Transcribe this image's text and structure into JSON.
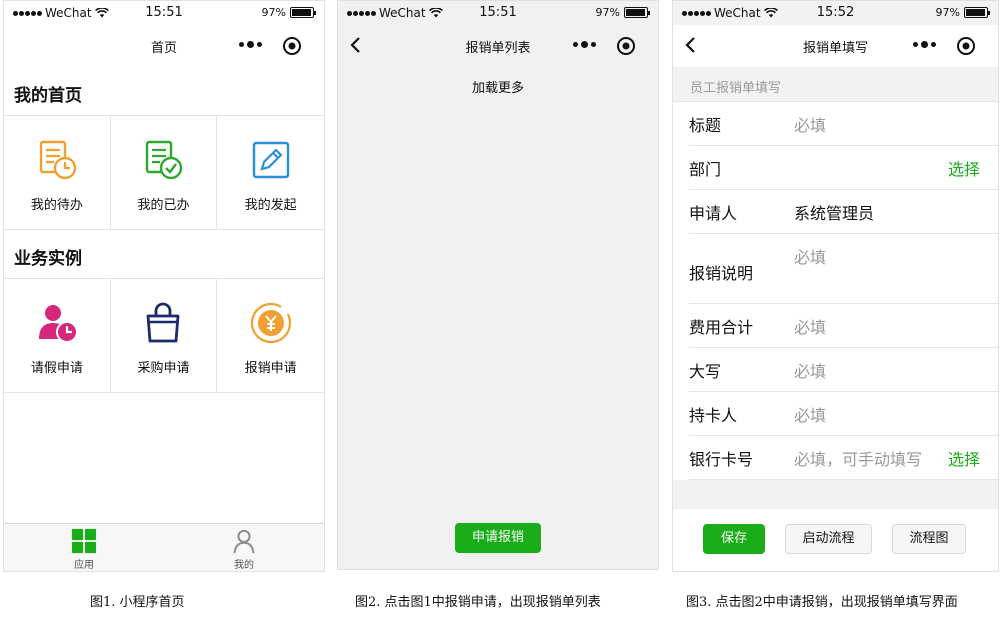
{
  "status": {
    "carrier": "WeChat",
    "battery": "97%",
    "time1": "15:51",
    "time2": "15:51",
    "time3": "15:52"
  },
  "screen1": {
    "nav_title": "首页",
    "section1_title": "我的首页",
    "section1_items": [
      {
        "label": "我的待办",
        "icon": "todo-clock-icon"
      },
      {
        "label": "我的已办",
        "icon": "done-check-icon"
      },
      {
        "label": "我的发起",
        "icon": "edit-pencil-icon"
      }
    ],
    "section2_title": "业务实例",
    "section2_items": [
      {
        "label": "请假申请",
        "icon": "leave-person-clock-icon"
      },
      {
        "label": "采购申请",
        "icon": "shopping-bag-icon"
      },
      {
        "label": "报销申请",
        "icon": "reimburse-coin-icon"
      }
    ],
    "tabs": [
      {
        "label": "应用",
        "icon": "grid-apps-icon",
        "color": "#1aad19"
      },
      {
        "label": "我的",
        "icon": "person-icon",
        "color": "#888888"
      }
    ]
  },
  "screen2": {
    "nav_title": "报销单列表",
    "load_more": "加载更多",
    "apply_button": "申请报销"
  },
  "screen3": {
    "nav_title": "报销单填写",
    "form_header": "员工报销单填写",
    "rows": [
      {
        "label": "标题",
        "value": "必填",
        "filled": false,
        "select": ""
      },
      {
        "label": "部门",
        "value": "",
        "filled": false,
        "select": "选择"
      },
      {
        "label": "申请人",
        "value": "系统管理员",
        "filled": true,
        "select": ""
      },
      {
        "label": "报销说明",
        "value": "必填",
        "filled": false,
        "select": ""
      },
      {
        "label": "费用合计",
        "value": "必填",
        "filled": false,
        "select": ""
      },
      {
        "label": "大写",
        "value": "必填",
        "filled": false,
        "select": ""
      },
      {
        "label": "持卡人",
        "value": "必填",
        "filled": false,
        "select": ""
      },
      {
        "label": "银行卡号",
        "value": "必填，可手动填写",
        "filled": false,
        "select": "选择"
      }
    ],
    "save_button": "保存",
    "start_flow_button": "启动流程",
    "flow_chart_button": "流程图"
  },
  "captions": {
    "fig1": "图1. 小程序首页",
    "fig2": "图2. 点击图1中报销申请，出现报销单列表",
    "fig3": "图3. 点击图2中申请报销，出现报销单填写界面"
  },
  "colors": {
    "accent_green": "#1aad19",
    "icon_orange": "#f0a030",
    "icon_green": "#2fa62f",
    "icon_blue": "#2b8fd6",
    "icon_pink": "#d6287a",
    "icon_navy": "#1c2a6b"
  }
}
